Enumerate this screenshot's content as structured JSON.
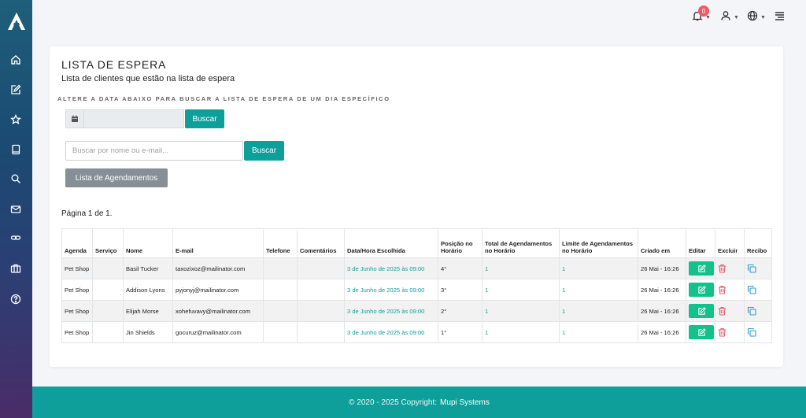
{
  "header": {
    "notification_count": "0"
  },
  "page": {
    "title": "LISTA DE ESPERA",
    "subtitle": "Lista de clientes que estão na lista de espera",
    "hint": "ALTERE A DATA ABAIXO PARA BUSCAR A LISTA DE ESPERA DE UM DIA ESPECÍFICO",
    "date_button": "Buscar",
    "search_placeholder": "Buscar por nome ou e-mail...",
    "search_button": "Buscar",
    "appointments_button": "Lista de Agendamentos",
    "page_info": "Página 1 de 1."
  },
  "table": {
    "headers": [
      "Agenda",
      "Serviço",
      "Nome",
      "E-mail",
      "Telefone",
      "Comentários",
      "Data/Hora Escolhida",
      "Posição no Horário",
      "Total de Agendamentos no Horário",
      "Limite de Agendamentos no Horário",
      "Criado em",
      "Editar",
      "Excluir",
      "Recibo"
    ],
    "rows": [
      {
        "agenda": "Pet Shop",
        "servico": "",
        "nome": "Basil Tucker",
        "email": "taxozixoz@mailinator.com",
        "telefone": "",
        "comentarios": "",
        "data_hora": "3 de Junho de 2025 às 09:00",
        "posicao": "4°",
        "total": "1",
        "limite": "1",
        "criado": "26 Mai - 16:26"
      },
      {
        "agenda": "Pet Shop",
        "servico": "",
        "nome": "Addison Lyons",
        "email": "pyjonyj@mailinator.com",
        "telefone": "",
        "comentarios": "",
        "data_hora": "3 de Junho de 2025 às 09:00",
        "posicao": "3°",
        "total": "1",
        "limite": "1",
        "criado": "26 Mai - 16:26"
      },
      {
        "agenda": "Pet Shop",
        "servico": "",
        "nome": "Elijah Morse",
        "email": "xohefuvavy@mailinator.com",
        "telefone": "",
        "comentarios": "",
        "data_hora": "3 de Junho de 2025 às 09:00",
        "posicao": "2°",
        "total": "1",
        "limite": "1",
        "criado": "26 Mai - 16:26"
      },
      {
        "agenda": "Pet Shop",
        "servico": "",
        "nome": "Jin Shields",
        "email": "gocuruz@mailinator.com",
        "telefone": "",
        "comentarios": "",
        "data_hora": "3 de Junho de 2025 às 09:00",
        "posicao": "1°",
        "total": "1",
        "limite": "1",
        "criado": "26 Mai - 16:26"
      }
    ]
  },
  "footer": {
    "copyright": "© 2020 - 2025 Copyright:",
    "brand": "Mupi Systems"
  },
  "colors": {
    "accent": "#0e9f9a",
    "edit": "#12c28a",
    "delete": "#e35d6a",
    "badge": "#ef5a69"
  }
}
